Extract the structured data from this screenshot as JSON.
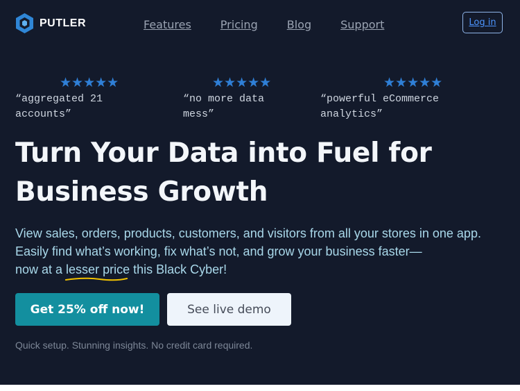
{
  "brand": {
    "name": "PUTLER"
  },
  "nav": [
    "Features",
    "Pricing",
    "Blog",
    "Support"
  ],
  "header": {
    "login": "Log in"
  },
  "reviews": [
    {
      "stars": "★★★★★",
      "quote": "“aggregated 21\naccounts”"
    },
    {
      "stars": "★★★★★",
      "quote": "“no more data\nmess”"
    },
    {
      "stars": "★★★★★",
      "quote": "“powerful eCommerce\nanalytics”"
    }
  ],
  "hero": {
    "headline_line1": "Turn Your Data into Fuel for",
    "headline_line2": "Business Growth",
    "sub_line1": "View sales, orders, products, customers, and visitors from all your stores in one app.",
    "sub_line2": "Easily find what’s working, fix what’s not, and grow your business faster—",
    "sub_line3_pre": "now at a ",
    "sub_line3_highlight": "lesser price",
    "sub_line3_post": " this Black Cyber!",
    "cta_primary": "Get 25% off now!",
    "cta_secondary": "See live demo",
    "note": "Quick setup. Stunning insights. No credit card required."
  },
  "colors": {
    "background": "#131a2b",
    "accent": "#138f9f",
    "star": "#2f7fd6",
    "highlight_underline": "#f2c200"
  }
}
